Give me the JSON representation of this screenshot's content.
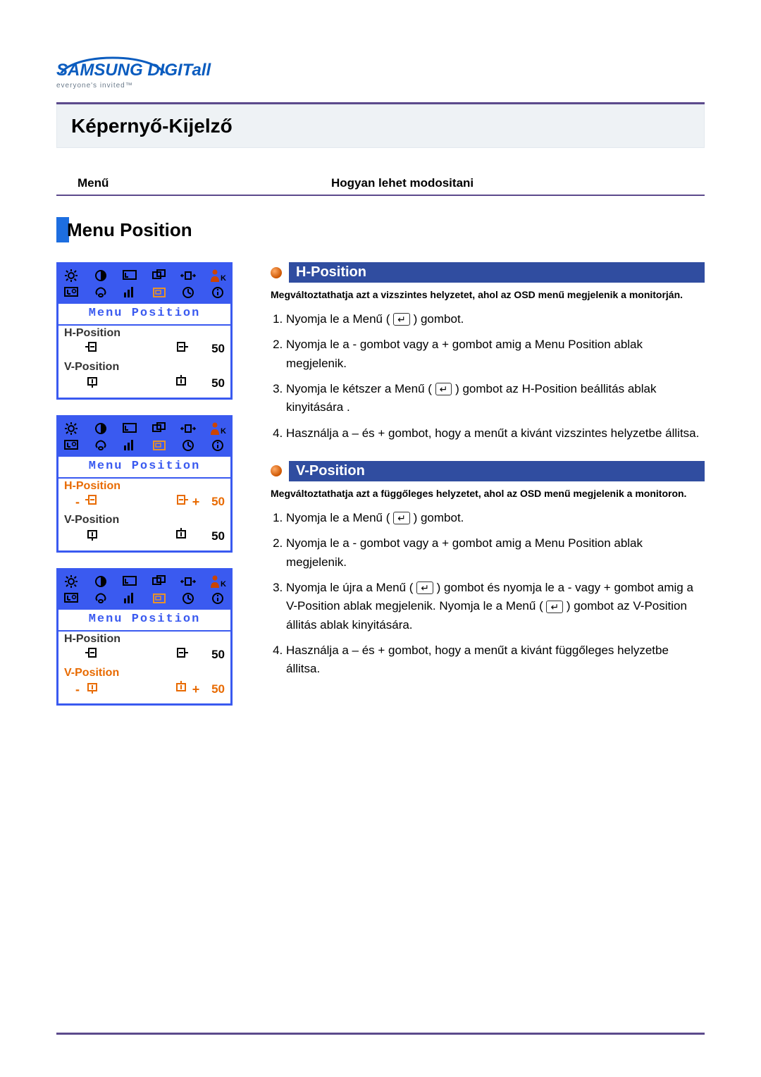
{
  "logo": {
    "brand": "SAMSUNG DIGITall",
    "tagline": "everyone's invited™"
  },
  "page_title": "Képernyő-Kijelző",
  "columns": {
    "left": "Menű",
    "right": "Hogyan lehet modositani"
  },
  "main_section_title": "Menu Position",
  "osd_panels": [
    {
      "title": "Menu Position",
      "h_highlight": false,
      "v_highlight": false,
      "h_label": "H-Position",
      "v_label": "V-Position",
      "h_val": "50",
      "v_val": "50",
      "h_controls": false,
      "v_controls": false
    },
    {
      "title": "Menu Position",
      "h_highlight": true,
      "v_highlight": false,
      "h_label": "H-Position",
      "v_label": "V-Position",
      "h_val": "50",
      "v_val": "50",
      "h_controls": true,
      "v_controls": false
    },
    {
      "title": "Menu Position",
      "h_highlight": false,
      "v_highlight": true,
      "h_label": "H-Position",
      "v_label": "V-Position",
      "h_val": "50",
      "v_val": "50",
      "h_controls": false,
      "v_controls": true
    }
  ],
  "sections": [
    {
      "title": "H-Position",
      "desc": "Megváltoztathatja azt a vizszintes helyzetet, ahol az OSD menű megjelenik a monitorján.",
      "steps": [
        "Nyomja le a Menű  ( ↵ ) gombot.",
        "Nyomja le a - gombot vagy a + gombot amig a Menu Position ablak megjelenik.",
        "Nyomja le kétszer a Menű ( ↵ ) gombot az H-Position beállitás ablak kinyitására .",
        "Használja a – és + gombot, hogy a menűt a kivánt vizszintes helyzetbe állitsa."
      ]
    },
    {
      "title": "V-Position",
      "desc": "Megváltoztathatja azt a függőleges helyzetet, ahol az OSD menű megjelenik a monitoron.",
      "steps": [
        "Nyomja le a Menű  ( ↵ ) gombot.",
        "Nyomja le a - gombot vagy a + gombot amig a Menu Position ablak megjelenik.",
        "Nyomja le újra a Menű ( ↵ ) gombot és nyomja le a - vagy + gombot amig a V-Position ablak megjelenik. Nyomja le a Menű ( ↵ ) gombot az V-Position állitás ablak kinyitására.",
        "Használja a – és + gombot, hogy a menűt a kivánt függőleges helyzetbe állitsa."
      ]
    }
  ]
}
